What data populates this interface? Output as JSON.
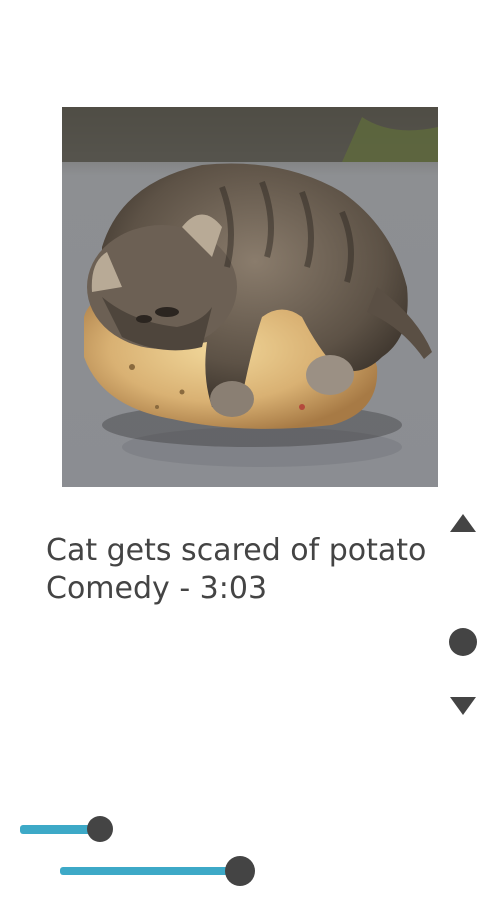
{
  "video": {
    "title": "Cat gets scared of potato",
    "subtitle": "Comedy - 3:03"
  },
  "thumbnail": {
    "icon": "kitten-on-potato-image"
  },
  "controls": {
    "up_icon": "triangle-up-icon",
    "dot_icon": "circle-icon",
    "down_icon": "triangle-down-icon"
  },
  "sliders": [
    {
      "name": "slider-1",
      "value_fraction": 0.83
    },
    {
      "name": "slider-2",
      "value_fraction": 0.9
    }
  ],
  "colors": {
    "accent": "#3da9c7",
    "text": "#444444",
    "knob": "#444444"
  }
}
